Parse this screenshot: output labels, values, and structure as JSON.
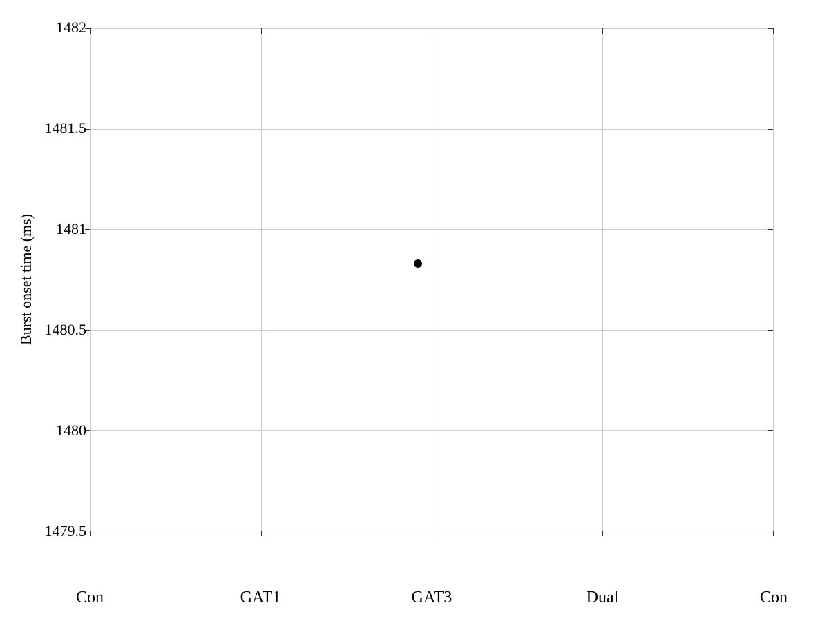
{
  "chart": {
    "title": "",
    "y_axis": {
      "title": "Burst onset time (ms)",
      "min": 1479.5,
      "max": 1482,
      "labels": [
        "1479.5",
        "1480",
        "1480.5",
        "1481",
        "1481.5",
        "1482"
      ],
      "tick_positions_pct": [
        100,
        80,
        60,
        40,
        20,
        0
      ]
    },
    "x_axis": {
      "labels": [
        "Con",
        "GAT1",
        "GAT3",
        "Dual",
        "Con"
      ],
      "positions_pct": [
        0,
        25,
        50,
        75,
        100
      ]
    },
    "data_points": [
      {
        "label": "GAT3 point",
        "x_pct": 50,
        "y_value": 1480.83,
        "y_min": 1479.5,
        "y_max": 1482,
        "color": "#000000"
      }
    ]
  }
}
